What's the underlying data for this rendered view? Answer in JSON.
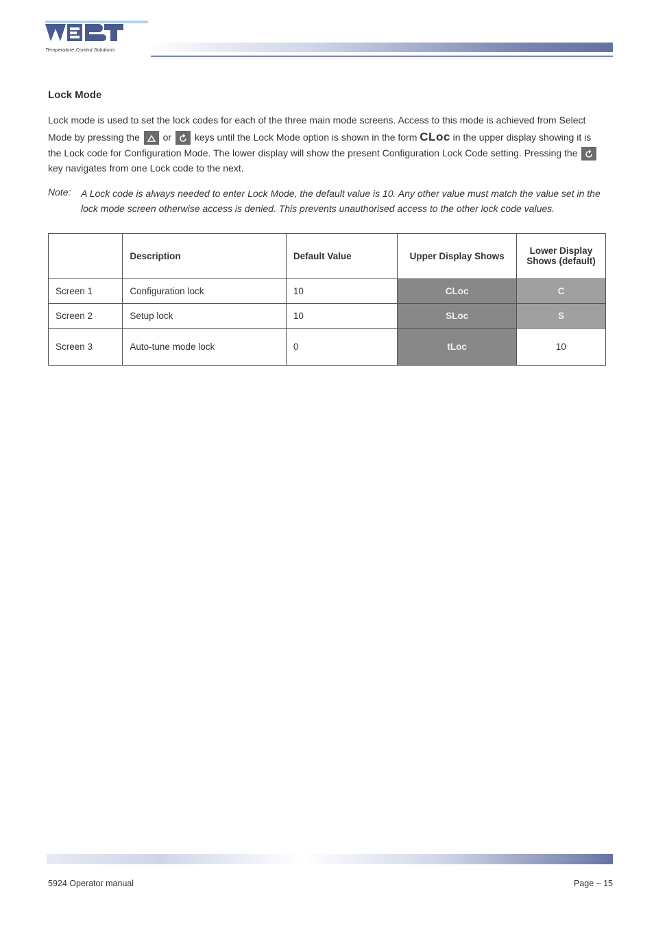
{
  "logo": {
    "brand": "WEST",
    "tagline": "Temperature Control Solutions"
  },
  "section": {
    "title": "Lock Mode",
    "p1_pre": "Lock mode is used to set the lock codes for each of the three main mode screens. Access to this mode is achieved from Select Mode by pressing the ",
    "p1_mid": " or ",
    "p1_after_keys": " keys until the Lock Mode option is shown in the form ",
    "lcd_1": "CLoc",
    "p1_tail1": " in the upper display showing it is the Lock code for Configuration Mode. The lower display will show the present Configuration Lock Code setting. Pressing the ",
    "p1_tail2": " key navigates from one Lock code to the next."
  },
  "note": {
    "label": "Note:",
    "body": "A Lock code is always needed to enter Lock Mode, the default value is 10. Any other value must match the value set in the lock mode screen otherwise access is denied. This prevents unauthorised access to the other lock code values."
  },
  "table": {
    "headers": {
      "blank": "",
      "description": "Description",
      "default": "Default Value",
      "upper": "Upper Display Shows",
      "lower": "Lower Display\n Shows (default)"
    },
    "rows": [
      {
        "label": "Screen 1",
        "desc": "Configuration lock",
        "default": "10",
        "upper": "CLoc",
        "lower": "C",
        "lower_light": true
      },
      {
        "label": "Screen 2",
        "desc": "Setup lock",
        "default": "10",
        "upper": "SLoc",
        "lower": "S",
        "lower_light": true
      },
      {
        "label": "Screen 3",
        "desc": "Auto-tune mode lock",
        "default": "0",
        "upper": "tLoc",
        "lower": "10",
        "lower_light": false,
        "lower_plain": true
      }
    ]
  },
  "footer": {
    "left": "5924 Operator manual",
    "right_pre": "Page ",
    "dash": "–",
    "right_post": " 15"
  }
}
